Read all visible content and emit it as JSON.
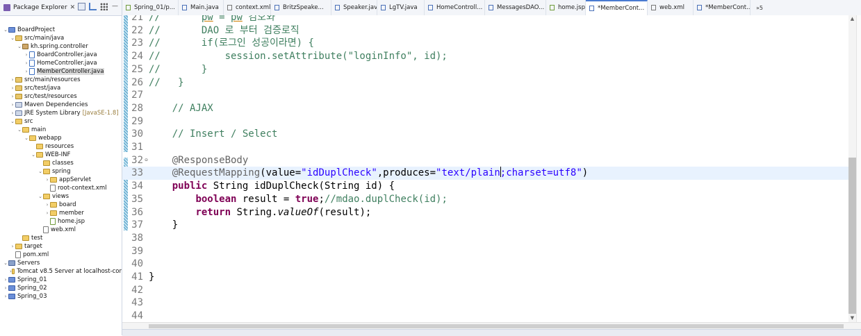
{
  "explorer": {
    "title": "Package Explorer",
    "close": "✕",
    "tree": [
      {
        "label": "BoardProject",
        "icon": "project",
        "depth": 0,
        "twisty": "v"
      },
      {
        "label": "src/main/java",
        "icon": "srcfolder",
        "depth": 1,
        "twisty": "v"
      },
      {
        "label": "kh.spring.controller",
        "icon": "package",
        "depth": 2,
        "twisty": "v"
      },
      {
        "label": "BoardController.java",
        "icon": "java",
        "depth": 3,
        "twisty": ">"
      },
      {
        "label": "HomeController.java",
        "icon": "java",
        "depth": 3,
        "twisty": ">"
      },
      {
        "label": "MemberController.java",
        "icon": "java",
        "depth": 3,
        "twisty": ">",
        "selected": true
      },
      {
        "label": "src/main/resources",
        "icon": "srcfolder",
        "depth": 1,
        "twisty": ">"
      },
      {
        "label": "src/test/java",
        "icon": "srcfolder",
        "depth": 1,
        "twisty": ">"
      },
      {
        "label": "src/test/resources",
        "icon": "srcfolder",
        "depth": 1,
        "twisty": ">"
      },
      {
        "label": "Maven Dependencies",
        "icon": "library",
        "depth": 1,
        "twisty": ">"
      },
      {
        "label": "JRE System Library",
        "icon": "library",
        "depth": 1,
        "twisty": ">",
        "decor": "[JavaSE-1.8]"
      },
      {
        "label": "src",
        "icon": "folder",
        "depth": 1,
        "twisty": "v"
      },
      {
        "label": "main",
        "icon": "folder",
        "depth": 2,
        "twisty": "v"
      },
      {
        "label": "webapp",
        "icon": "folder",
        "depth": 3,
        "twisty": "v"
      },
      {
        "label": "resources",
        "icon": "folder",
        "depth": 4,
        "twisty": ""
      },
      {
        "label": "WEB-INF",
        "icon": "folder",
        "depth": 4,
        "twisty": "v"
      },
      {
        "label": "classes",
        "icon": "folder",
        "depth": 5,
        "twisty": ""
      },
      {
        "label": "spring",
        "icon": "folder",
        "depth": 5,
        "twisty": "v"
      },
      {
        "label": "appServlet",
        "icon": "folder",
        "depth": 6,
        "twisty": ">"
      },
      {
        "label": "root-context.xml",
        "icon": "xml",
        "depth": 6,
        "twisty": ""
      },
      {
        "label": "views",
        "icon": "folder",
        "depth": 5,
        "twisty": "v"
      },
      {
        "label": "board",
        "icon": "folder",
        "depth": 6,
        "twisty": ">"
      },
      {
        "label": "member",
        "icon": "folder",
        "depth": 6,
        "twisty": ">"
      },
      {
        "label": "home.jsp",
        "icon": "jsp",
        "depth": 6,
        "twisty": ""
      },
      {
        "label": "web.xml",
        "icon": "xml",
        "depth": 5,
        "twisty": ""
      },
      {
        "label": "test",
        "icon": "folder",
        "depth": 2,
        "twisty": ""
      },
      {
        "label": "target",
        "icon": "folder",
        "depth": 1,
        "twisty": ">"
      },
      {
        "label": "pom.xml",
        "icon": "xml",
        "depth": 1,
        "twisty": ""
      },
      {
        "label": "Servers",
        "icon": "servers",
        "depth": 0,
        "twisty": "v"
      },
      {
        "label": "Tomcat v8.5 Server at localhost-cor",
        "icon": "folder",
        "depth": 1,
        "twisty": ">"
      },
      {
        "label": "Spring_01",
        "icon": "project",
        "depth": 0,
        "twisty": ">"
      },
      {
        "label": "Spring_02",
        "icon": "project",
        "depth": 0,
        "twisty": ">"
      },
      {
        "label": "Spring_03",
        "icon": "project",
        "depth": 0,
        "twisty": ">"
      }
    ]
  },
  "tabs": [
    {
      "label": "Spring_01/p...",
      "icon": "j",
      "width": 81
    },
    {
      "label": "Main.java",
      "icon": "",
      "width": 65
    },
    {
      "label": "context.xml",
      "icon": "x",
      "width": 68
    },
    {
      "label": "BritzSpeake...",
      "icon": "",
      "width": 87
    },
    {
      "label": "Speaker.java",
      "icon": "",
      "width": 66
    },
    {
      "label": "LgTV.java",
      "icon": "",
      "width": 68
    },
    {
      "label": "HomeControll...",
      "icon": "",
      "width": 87
    },
    {
      "label": "MessagesDAO...",
      "icon": "",
      "width": 88
    },
    {
      "label": "home.jsp",
      "icon": "j",
      "width": 57
    },
    {
      "label": "*MemberCont...",
      "icon": "",
      "width": 89,
      "active": true
    },
    {
      "label": "web.xml",
      "icon": "x",
      "width": 66
    },
    {
      "label": "*MemberCont...",
      "icon": "",
      "width": 82
    }
  ],
  "tab_overflow": "»5",
  "editor": {
    "lines": [
      {
        "num": "21",
        "html": "<span class=\"cm\">//       <span class=\"und\">pw</span> = <span class=\"und\">pw</span> 검오와</span>"
      },
      {
        "num": "22",
        "html": "<span class=\"cm\">//       DAO 로 부터 검증로직</span>"
      },
      {
        "num": "23",
        "html": "<span class=\"cm\">//       if(로그인 성공이라면) {</span>"
      },
      {
        "num": "24",
        "html": "<span class=\"cm\">//           session.setAttribute(\"loginInfo\", id);</span>"
      },
      {
        "num": "25",
        "html": "<span class=\"cm\">//       }</span>"
      },
      {
        "num": "26",
        "html": "<span class=\"cm\">//   }</span>"
      },
      {
        "num": "27",
        "html": ""
      },
      {
        "num": "28",
        "html": "    <span class=\"cm\">// AJAX</span>"
      },
      {
        "num": "29",
        "html": ""
      },
      {
        "num": "30",
        "html": "    <span class=\"cm\">// Insert / Select</span>"
      },
      {
        "num": "31",
        "html": ""
      },
      {
        "num": "32",
        "html": "    <span class=\"an\">@ResponseBody</span>",
        "fold": true
      },
      {
        "num": "33",
        "html": "    <span class=\"an\">@RequestMapping</span>(value=<span class=\"str\">\"idDuplCheck\"</span>,produces=<span class=\"str\">\"text/plain<span class=\"caret\"></span>;charset=utf8\"</span>)",
        "current": true
      },
      {
        "num": "34",
        "html": "    <span class=\"kw\">public</span> String idDuplCheck(String id) {"
      },
      {
        "num": "35",
        "html": "        <span class=\"kw\">boolean</span> result = <span class=\"kw\">true</span>;<span class=\"cm\">//mdao.duplCheck(id);</span>"
      },
      {
        "num": "36",
        "html": "        <span class=\"kw\">return</span> String.<span class=\"it\">valueOf</span>(result);"
      },
      {
        "num": "37",
        "html": "    }"
      },
      {
        "num": "38",
        "html": ""
      },
      {
        "num": "39",
        "html": ""
      },
      {
        "num": "40",
        "html": ""
      },
      {
        "num": "41",
        "html": "}"
      },
      {
        "num": "42",
        "html": ""
      },
      {
        "num": "43",
        "html": ""
      },
      {
        "num": "44",
        "html": ""
      }
    ]
  },
  "colors": {
    "comment": "#3f7f5f",
    "keyword": "#7f0055",
    "string": "#2a00ff",
    "annotation": "#646464",
    "current_line": "#e8f2fe",
    "active_tab_accent": "#4a7bd0"
  }
}
